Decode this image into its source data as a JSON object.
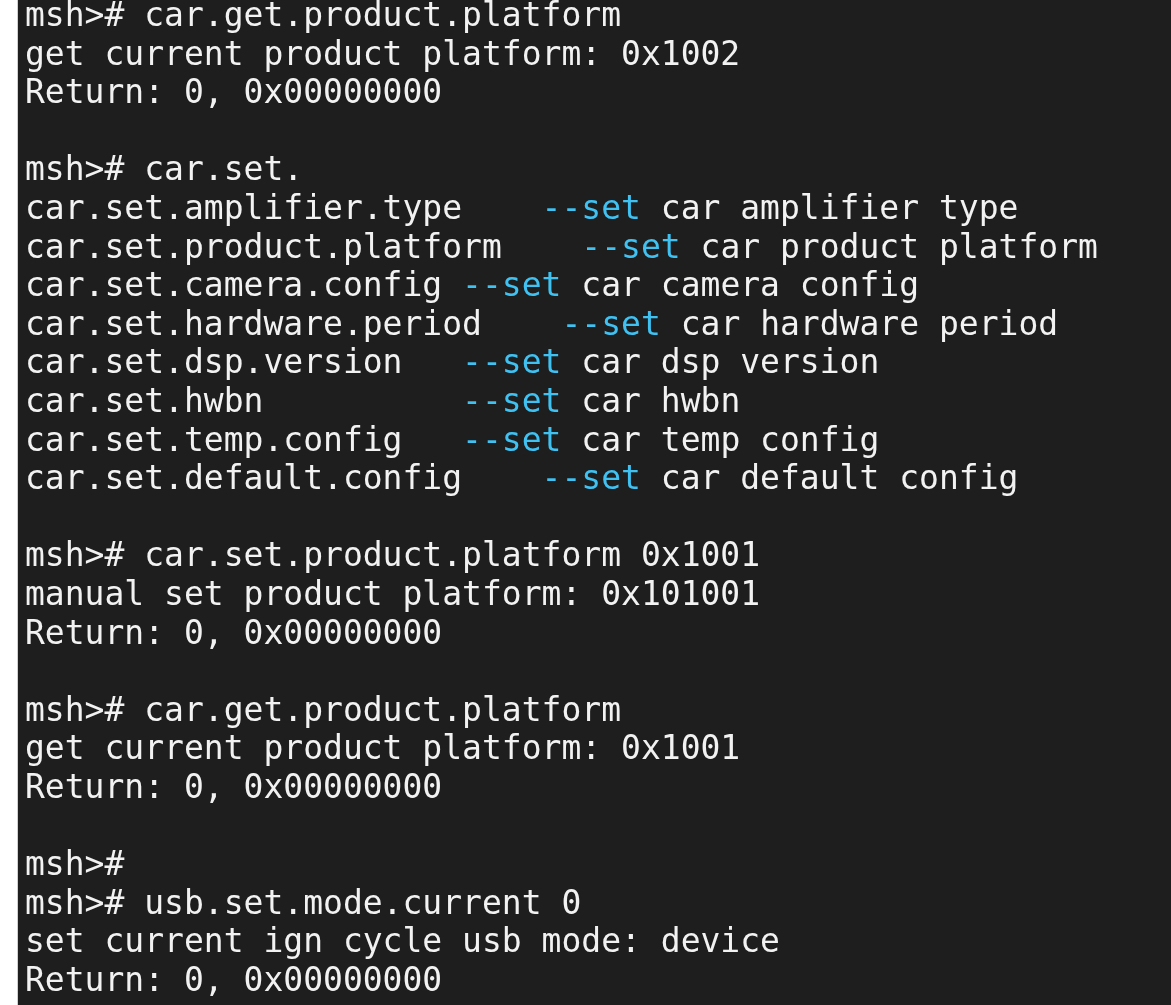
{
  "terminal": {
    "lines": [
      {
        "kind": "text",
        "text": "msh># car.get.product.platform"
      },
      {
        "kind": "text",
        "text": "get current product platform: 0x1002"
      },
      {
        "kind": "text",
        "text": "Return: 0, 0x00000000"
      },
      {
        "kind": "blank"
      },
      {
        "kind": "text",
        "text": "msh># car.set."
      },
      {
        "kind": "help",
        "command": "car.set.amplifier.type    ",
        "flag": "--set",
        "description": "car amplifier type"
      },
      {
        "kind": "help",
        "command": "car.set.product.platform    ",
        "flag": "--set",
        "description": "car product platform"
      },
      {
        "kind": "help",
        "command": "car.set.camera.config ",
        "flag": "--set",
        "description": "car camera config"
      },
      {
        "kind": "help",
        "command": "car.set.hardware.period    ",
        "flag": "--set",
        "description": "car hardware period"
      },
      {
        "kind": "help",
        "command": "car.set.dsp.version   ",
        "flag": "--set",
        "description": "car dsp version"
      },
      {
        "kind": "help",
        "command": "car.set.hwbn          ",
        "flag": "--set",
        "description": "car hwbn"
      },
      {
        "kind": "help",
        "command": "car.set.temp.config   ",
        "flag": "--set",
        "description": "car temp config"
      },
      {
        "kind": "help",
        "command": "car.set.default.config    ",
        "flag": "--set",
        "description": "car default config"
      },
      {
        "kind": "blank"
      },
      {
        "kind": "text",
        "text": "msh># car.set.product.platform 0x1001"
      },
      {
        "kind": "text",
        "text": "manual set product platform: 0x101001"
      },
      {
        "kind": "text",
        "text": "Return: 0, 0x00000000"
      },
      {
        "kind": "blank"
      },
      {
        "kind": "text",
        "text": "msh># car.get.product.platform"
      },
      {
        "kind": "text",
        "text": "get current product platform: 0x1001"
      },
      {
        "kind": "text",
        "text": "Return: 0, 0x00000000"
      },
      {
        "kind": "blank"
      },
      {
        "kind": "text",
        "text": "msh>#"
      },
      {
        "kind": "text",
        "text": "msh># usb.set.mode.current 0"
      },
      {
        "kind": "text",
        "text": "set current ign cycle usb mode: device"
      },
      {
        "kind": "text",
        "text": "Return: 0, 0x00000000"
      }
    ]
  }
}
